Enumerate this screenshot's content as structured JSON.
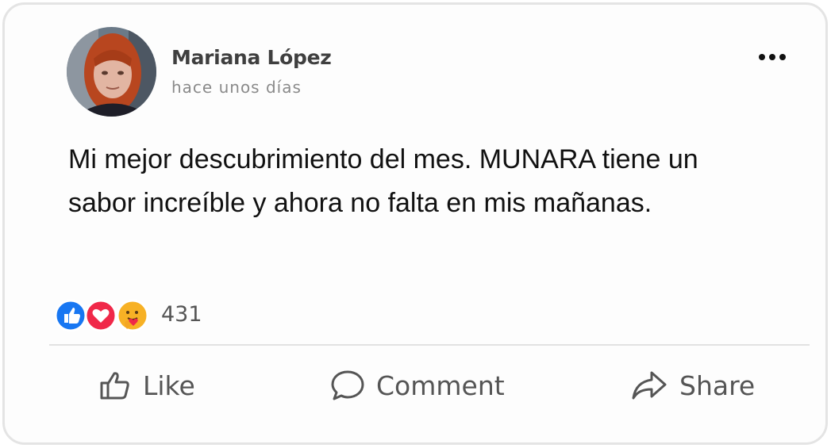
{
  "post": {
    "author": "Mariana López",
    "time": "hace unos días",
    "text": "Mi mejor descubrimiento del mes. MUNARA tiene un sabor increíble y ahora no falta en mis mañanas."
  },
  "reactions": {
    "icons": [
      "like-icon",
      "love-icon",
      "care-icon"
    ],
    "count": "431",
    "colors": {
      "like": "#1877f2",
      "love": "#f02849",
      "care": "#f7b125"
    }
  },
  "actions": {
    "like": "Like",
    "comment": "Comment",
    "share": "Share"
  },
  "menu": {
    "icon": "more-options-icon"
  }
}
